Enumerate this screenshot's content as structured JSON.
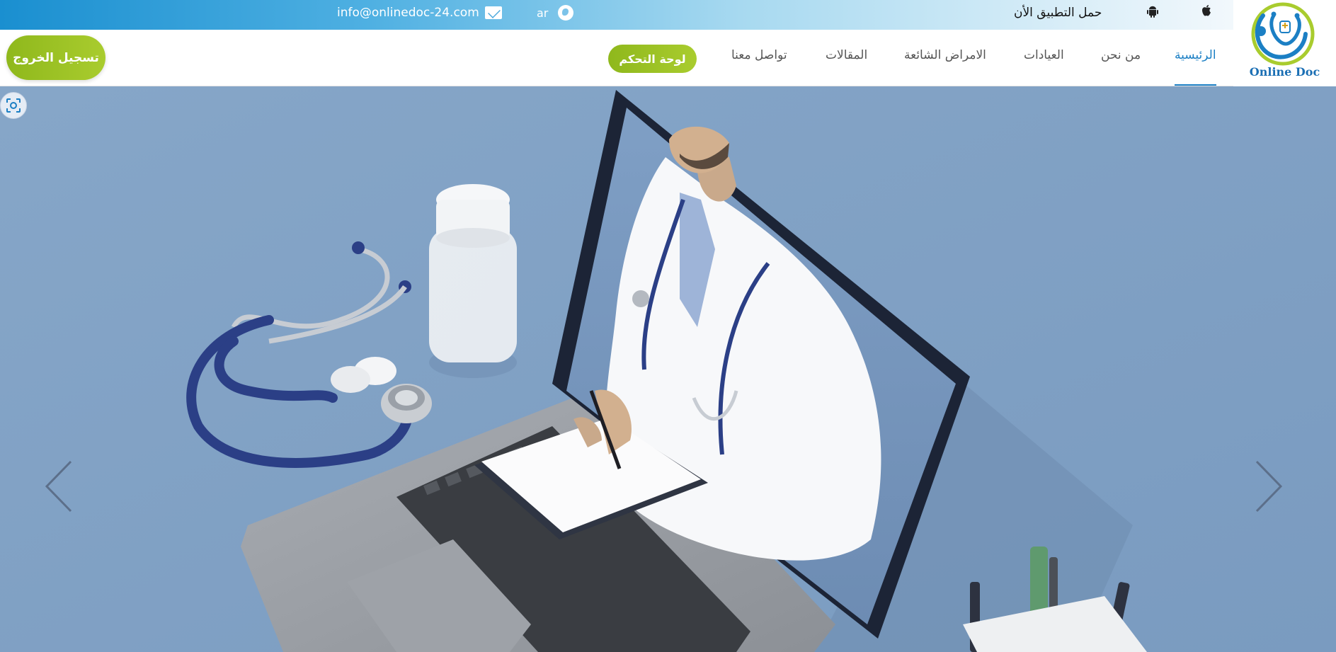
{
  "topbar": {
    "email": "info@onlinedoc-24.com",
    "email_icon": "envelope-icon",
    "language": "ar",
    "language_icon": "globe-icon",
    "download_app": "حمل التطبيق الأن",
    "android_icon": "android-icon",
    "apple_icon": "apple-icon"
  },
  "logo": {
    "text": "Online Doc",
    "icon": "stethoscope-logo-icon",
    "colors": {
      "primary": "#1b7fc4",
      "accent": "#a9cc2e"
    }
  },
  "nav": {
    "items": [
      {
        "label": "الرئيسية",
        "active": true
      },
      {
        "label": "من نحن"
      },
      {
        "label": "العيادات"
      },
      {
        "label": "الامراض الشائعة"
      },
      {
        "label": "المقالات"
      },
      {
        "label": "تواصل معنا"
      }
    ],
    "dashboard_label": "لوحة التحكم",
    "logout_label": "تسجيل الخروج",
    "accent_color": "#a9cc2e",
    "active_color": "#1b7fc4"
  },
  "hero": {
    "image_description": "doctor-in-laptop-illustration",
    "prev_icon": "chevron-left-icon",
    "next_icon": "chevron-right-icon",
    "scan_icon": "scan-icon",
    "background_color": "#7fa0c4"
  }
}
